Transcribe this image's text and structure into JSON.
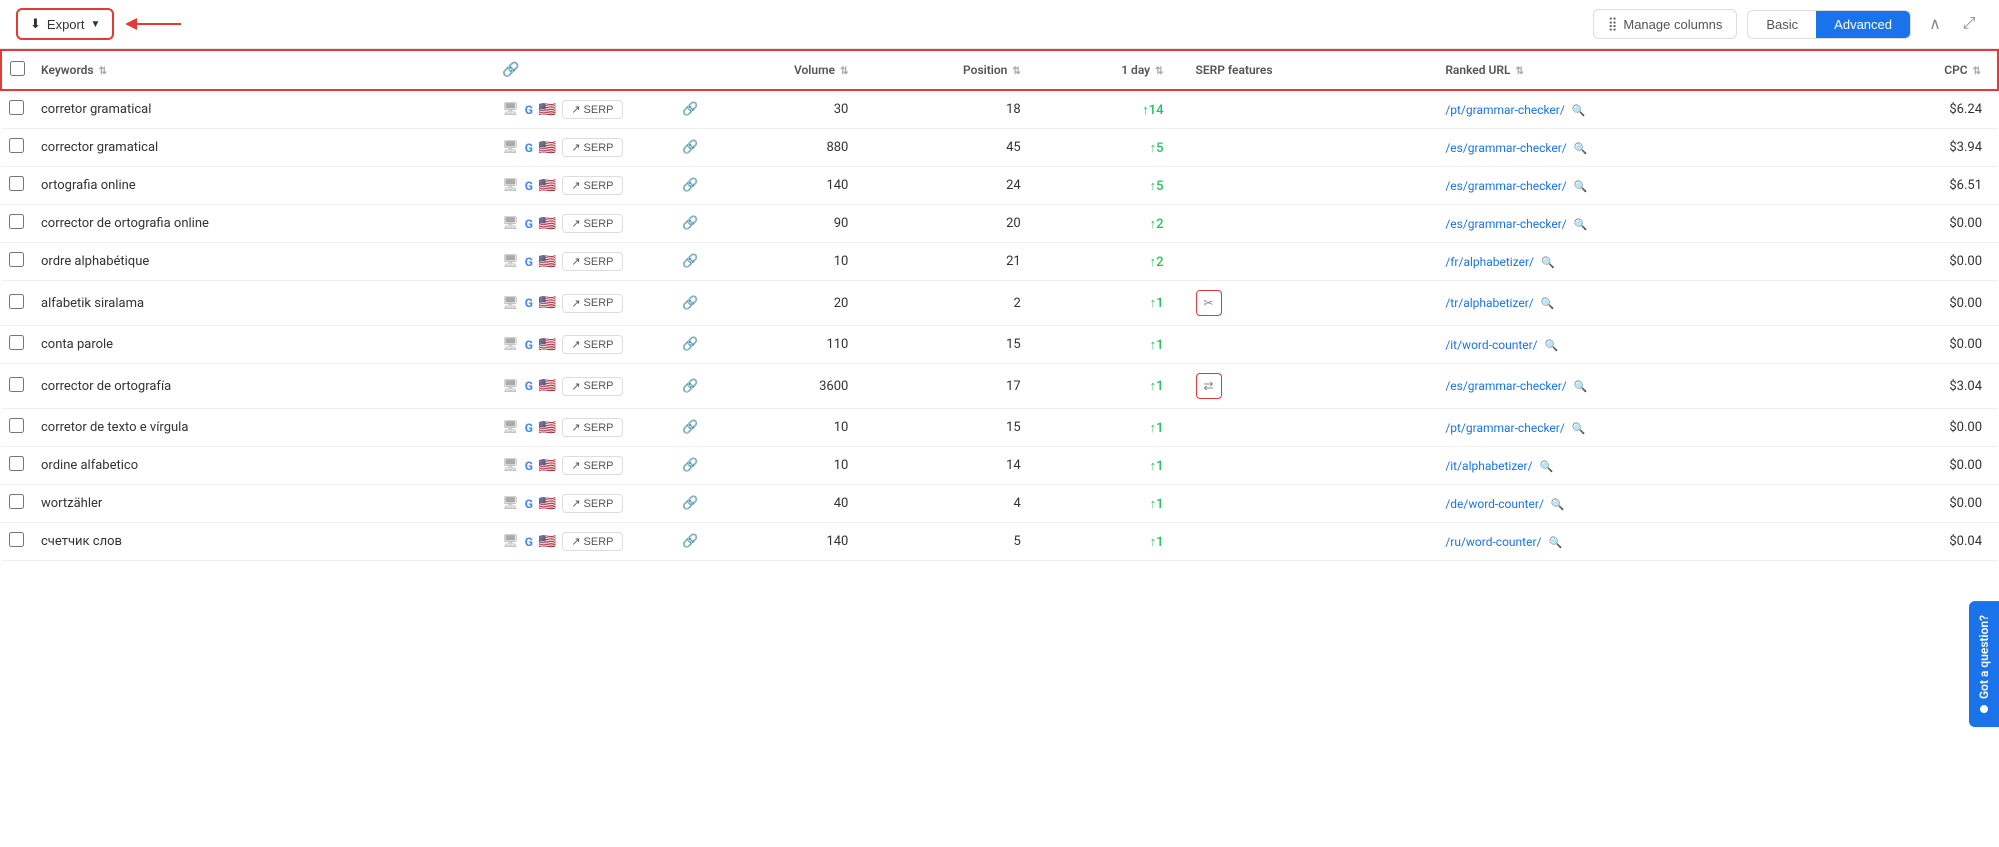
{
  "toolbar": {
    "export_label": "Export",
    "manage_columns_label": "Manage columns",
    "tab_basic": "Basic",
    "tab_advanced": "Advanced",
    "chevron_up": "∧",
    "fullscreen": "⤢"
  },
  "table": {
    "columns": [
      {
        "key": "checkbox",
        "label": ""
      },
      {
        "key": "keyword",
        "label": "Keywords"
      },
      {
        "key": "tools",
        "label": ""
      },
      {
        "key": "link",
        "label": ""
      },
      {
        "key": "volume",
        "label": "Volume"
      },
      {
        "key": "position",
        "label": "Position"
      },
      {
        "key": "day1",
        "label": "1 day"
      },
      {
        "key": "serp",
        "label": "SERP features"
      },
      {
        "key": "url",
        "label": "Ranked URL"
      },
      {
        "key": "cpc",
        "label": "CPC"
      }
    ],
    "rows": [
      {
        "keyword": "corretor gramatical",
        "volume": "30",
        "position": "18",
        "day1": "+14",
        "day1_dir": "up",
        "serp_icon": null,
        "url": "/pt/grammar-checker/",
        "cpc": "$6.24"
      },
      {
        "keyword": "corrector gramatical",
        "volume": "880",
        "position": "45",
        "day1": "+5",
        "day1_dir": "up",
        "serp_icon": null,
        "url": "/es/grammar-checker/",
        "cpc": "$3.94"
      },
      {
        "keyword": "ortografia online",
        "volume": "140",
        "position": "24",
        "day1": "+5",
        "day1_dir": "up",
        "serp_icon": null,
        "url": "/es/grammar-checker/",
        "cpc": "$6.51"
      },
      {
        "keyword": "corrector de ortografia online",
        "volume": "90",
        "position": "20",
        "day1": "+2",
        "day1_dir": "up",
        "serp_icon": null,
        "url": "/es/grammar-checker/",
        "cpc": "$0.00"
      },
      {
        "keyword": "ordre alphabétique",
        "volume": "10",
        "position": "21",
        "day1": "+2",
        "day1_dir": "up",
        "serp_icon": null,
        "url": "/fr/alphabetizer/",
        "cpc": "$0.00"
      },
      {
        "keyword": "alfabetik siralama",
        "volume": "20",
        "position": "2",
        "day1": "+1",
        "day1_dir": "up",
        "serp_icon": "scissors",
        "url": "/tr/alphabetizer/",
        "cpc": "$0.00"
      },
      {
        "keyword": "conta parole",
        "volume": "110",
        "position": "15",
        "day1": "+1",
        "day1_dir": "up",
        "serp_icon": null,
        "url": "/it/word-counter/",
        "cpc": "$0.00"
      },
      {
        "keyword": "corrector de ortografía",
        "volume": "3600",
        "position": "17",
        "day1": "+1",
        "day1_dir": "up",
        "serp_icon": "transfer",
        "url": "/es/grammar-checker/",
        "cpc": "$3.04"
      },
      {
        "keyword": "corretor de texto e vírgula",
        "volume": "10",
        "position": "15",
        "day1": "+1",
        "day1_dir": "up",
        "serp_icon": null,
        "url": "/pt/grammar-checker/",
        "cpc": "$0.00"
      },
      {
        "keyword": "ordine alfabetico",
        "volume": "10",
        "position": "14",
        "day1": "+1",
        "day1_dir": "up",
        "serp_icon": null,
        "url": "/it/alphabetizer/",
        "cpc": "$0.00"
      },
      {
        "keyword": "wortzähler",
        "volume": "40",
        "position": "4",
        "day1": "+1",
        "day1_dir": "up",
        "serp_icon": null,
        "url": "/de/word-counter/",
        "cpc": "$0.00"
      },
      {
        "keyword": "счетчик слов",
        "volume": "140",
        "position": "5",
        "day1": "+1",
        "day1_dir": "up",
        "serp_icon": null,
        "url": "/ru/word-counter/",
        "cpc": "$0.04"
      }
    ]
  },
  "got_question": "Got a question?"
}
